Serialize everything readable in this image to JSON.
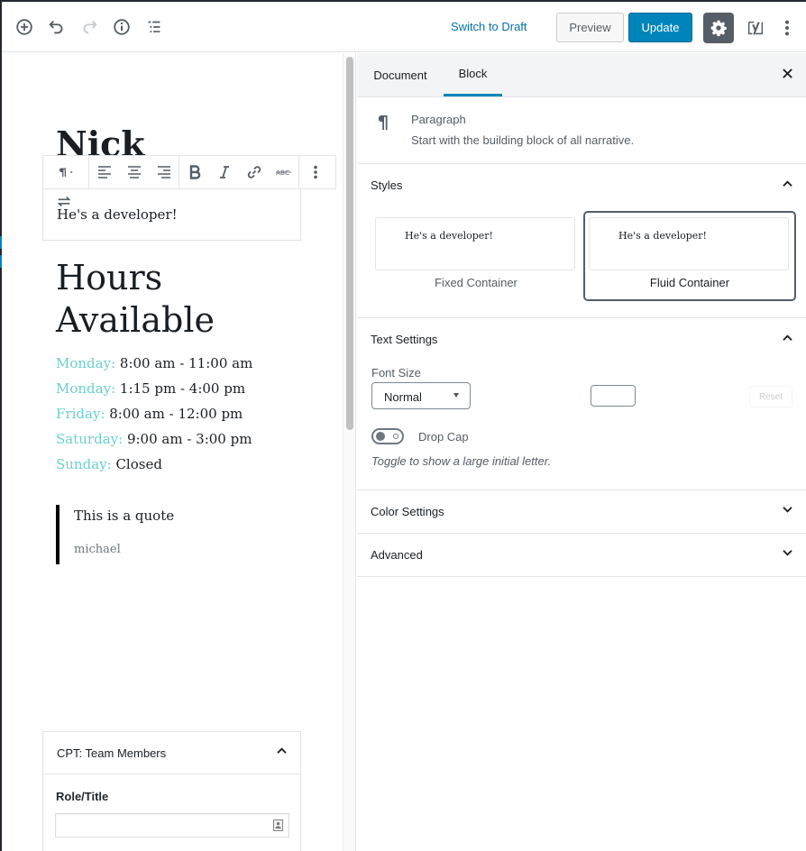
{
  "header": {
    "add_block_label": "Add block",
    "switch_to_draft": "Switch to Draft",
    "preview": "Preview",
    "update": "Update"
  },
  "editor": {
    "post_title": "Nick",
    "paragraph_text": "He's a developer!",
    "hours_heading": "Hours Available",
    "hours": [
      {
        "day": "Monday:",
        "time": "8:00 am - 11:00 am"
      },
      {
        "day": "Monday:",
        "time": "1:15 pm - 4:00 pm"
      },
      {
        "day": "Friday:",
        "time": "8:00 am - 12:00 pm"
      },
      {
        "day": "Saturday:",
        "time": "9:00 am - 3:00 pm"
      },
      {
        "day": "Sunday:",
        "time": "Closed"
      }
    ],
    "quote": {
      "text": "This is a quote",
      "citation": "michael"
    },
    "metabox": {
      "title": "CPT: Team Members",
      "field_label": "Role/Title",
      "field_value": ""
    }
  },
  "sidebar": {
    "tabs": [
      {
        "label": "Document",
        "active": false
      },
      {
        "label": "Block",
        "active": true
      }
    ],
    "block_card": {
      "title": "Paragraph",
      "description": "Start with the building block of all narrative."
    },
    "panels": {
      "styles": {
        "title": "Styles",
        "expanded": true,
        "options": [
          {
            "label": "Fixed Container",
            "preview": "He's a developer!",
            "selected": false
          },
          {
            "label": "Fluid Container",
            "preview": "He's a developer!",
            "selected": true
          }
        ]
      },
      "text_settings": {
        "title": "Text Settings",
        "expanded": true,
        "font_size_label": "Font Size",
        "font_size_value": "Normal",
        "custom_size_value": "",
        "reset_label": "Reset",
        "drop_cap_label": "Drop Cap",
        "drop_cap_enabled": false,
        "drop_cap_help": "Toggle to show a large initial letter."
      },
      "color_settings": {
        "title": "Color Settings",
        "expanded": false
      },
      "advanced": {
        "title": "Advanced",
        "expanded": false
      }
    }
  },
  "colors": {
    "accent": "#0085ba",
    "link": "#0073aa",
    "day_label": "#6ccfcf",
    "settings_active_bg": "#555d66"
  }
}
